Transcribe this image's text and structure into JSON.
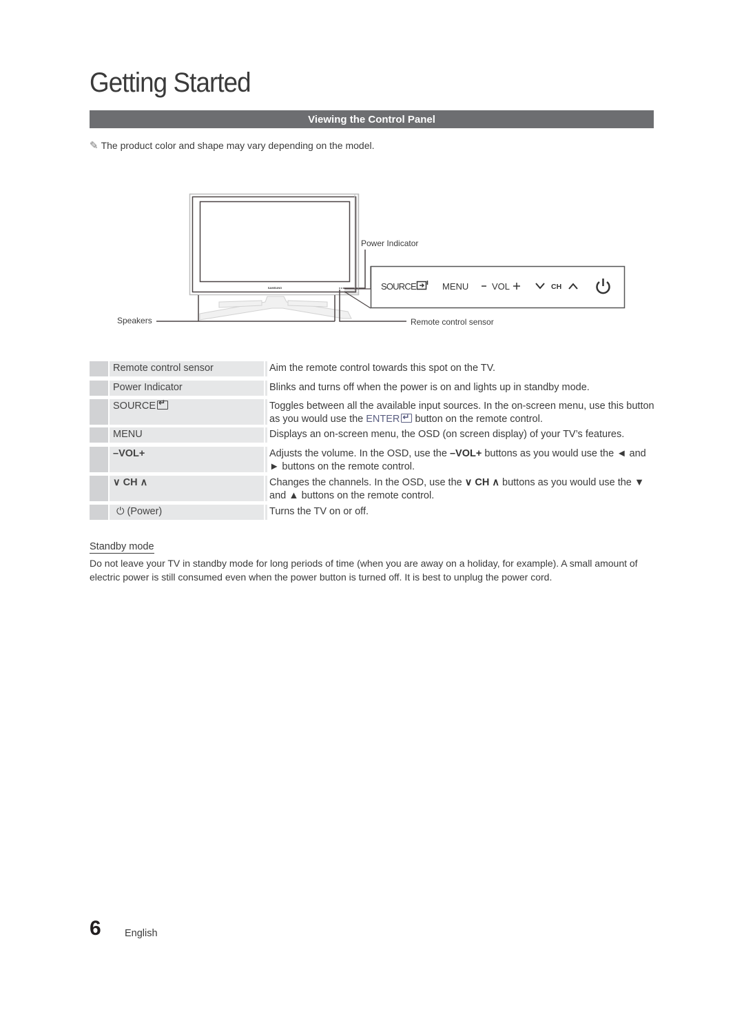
{
  "page": {
    "title": "Getting Started",
    "section_title": "Viewing the Control Panel",
    "note": "The product color and shape may vary depending on the model.",
    "note_icon": "pencil-note-icon"
  },
  "diagram": {
    "labels": {
      "power_indicator": "Power Indicator",
      "speakers": "Speakers",
      "remote_sensor": "Remote control sensor",
      "brand": "SAMSUNG"
    },
    "panel_buttons": {
      "source": "SOURCE",
      "menu": "MENU",
      "vol_minus": "–",
      "vol": "VOL",
      "vol_plus": "+",
      "ch": "CH"
    }
  },
  "table": {
    "rows": [
      {
        "name": "Remote control sensor",
        "desc": "Aim the remote control towards this spot on the TV."
      },
      {
        "name": "Power Indicator",
        "desc": "Blinks and turns off when the power is on and lights up in standby mode."
      },
      {
        "name": "SOURCE",
        "desc_a": "Toggles between all the available input sources. In the on-screen menu, use this button as you would use the ",
        "desc_kw": "ENTER",
        "desc_b": " button on the remote control."
      },
      {
        "name": "MENU",
        "desc": "Displays an on-screen menu, the OSD (on screen display) of your TV’s features."
      },
      {
        "name": "–VOL+",
        "desc_a": "Adjusts the volume. In the OSD, use the ",
        "desc_kw": "–VOL+",
        "desc_b": " buttons as you would use the ◄ and ► buttons on the remote control."
      },
      {
        "name": "CH",
        "desc_a": "Changes the channels. In the OSD, use the ",
        "desc_kw": "CH",
        "desc_b": " buttons as you would use the ▼ and ▲ buttons on the remote control."
      },
      {
        "name": "(Power)",
        "desc": "Turns the TV on or off."
      }
    ]
  },
  "standby": {
    "title": "Standby mode",
    "body": "Do not leave your TV in standby mode for long periods of time (when you are away on a holiday, for example). A small amount of electric power is still consumed even when the power button is turned off. It is best to unplug the power cord."
  },
  "footer": {
    "page_number": "6",
    "language": "English"
  }
}
